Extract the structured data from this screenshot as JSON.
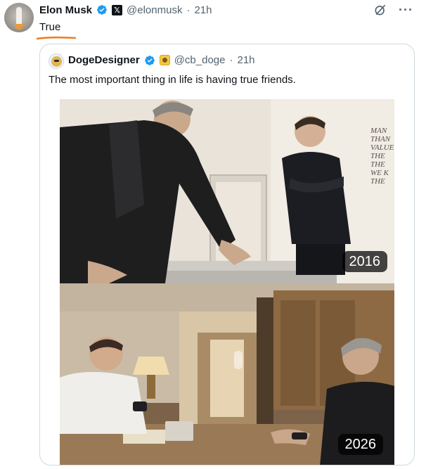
{
  "tweet": {
    "author_name": "Elon Musk",
    "handle": "@elonmusk",
    "time": "21h",
    "text": "True",
    "icons": [
      "verified-badge",
      "x-affiliate-badge",
      "grok-icon",
      "more-icon"
    ]
  },
  "quoted_tweet": {
    "author_name": "DogeDesigner",
    "handle": "@cb_doge",
    "time": "21h",
    "text": "The most important thing in life is having true friends.",
    "photos": [
      {
        "year_label": "2016",
        "wall_text": [
          "MAN",
          "THAN",
          "VALUE",
          "THE",
          "THE",
          "WE K",
          "THE"
        ]
      },
      {
        "year_label": "2026"
      }
    ]
  },
  "colors": {
    "verified_blue": "#1d9bf0",
    "secondary_text": "#536471",
    "underline_orange": "#f07b1f",
    "card_border": "#cfd9de"
  }
}
